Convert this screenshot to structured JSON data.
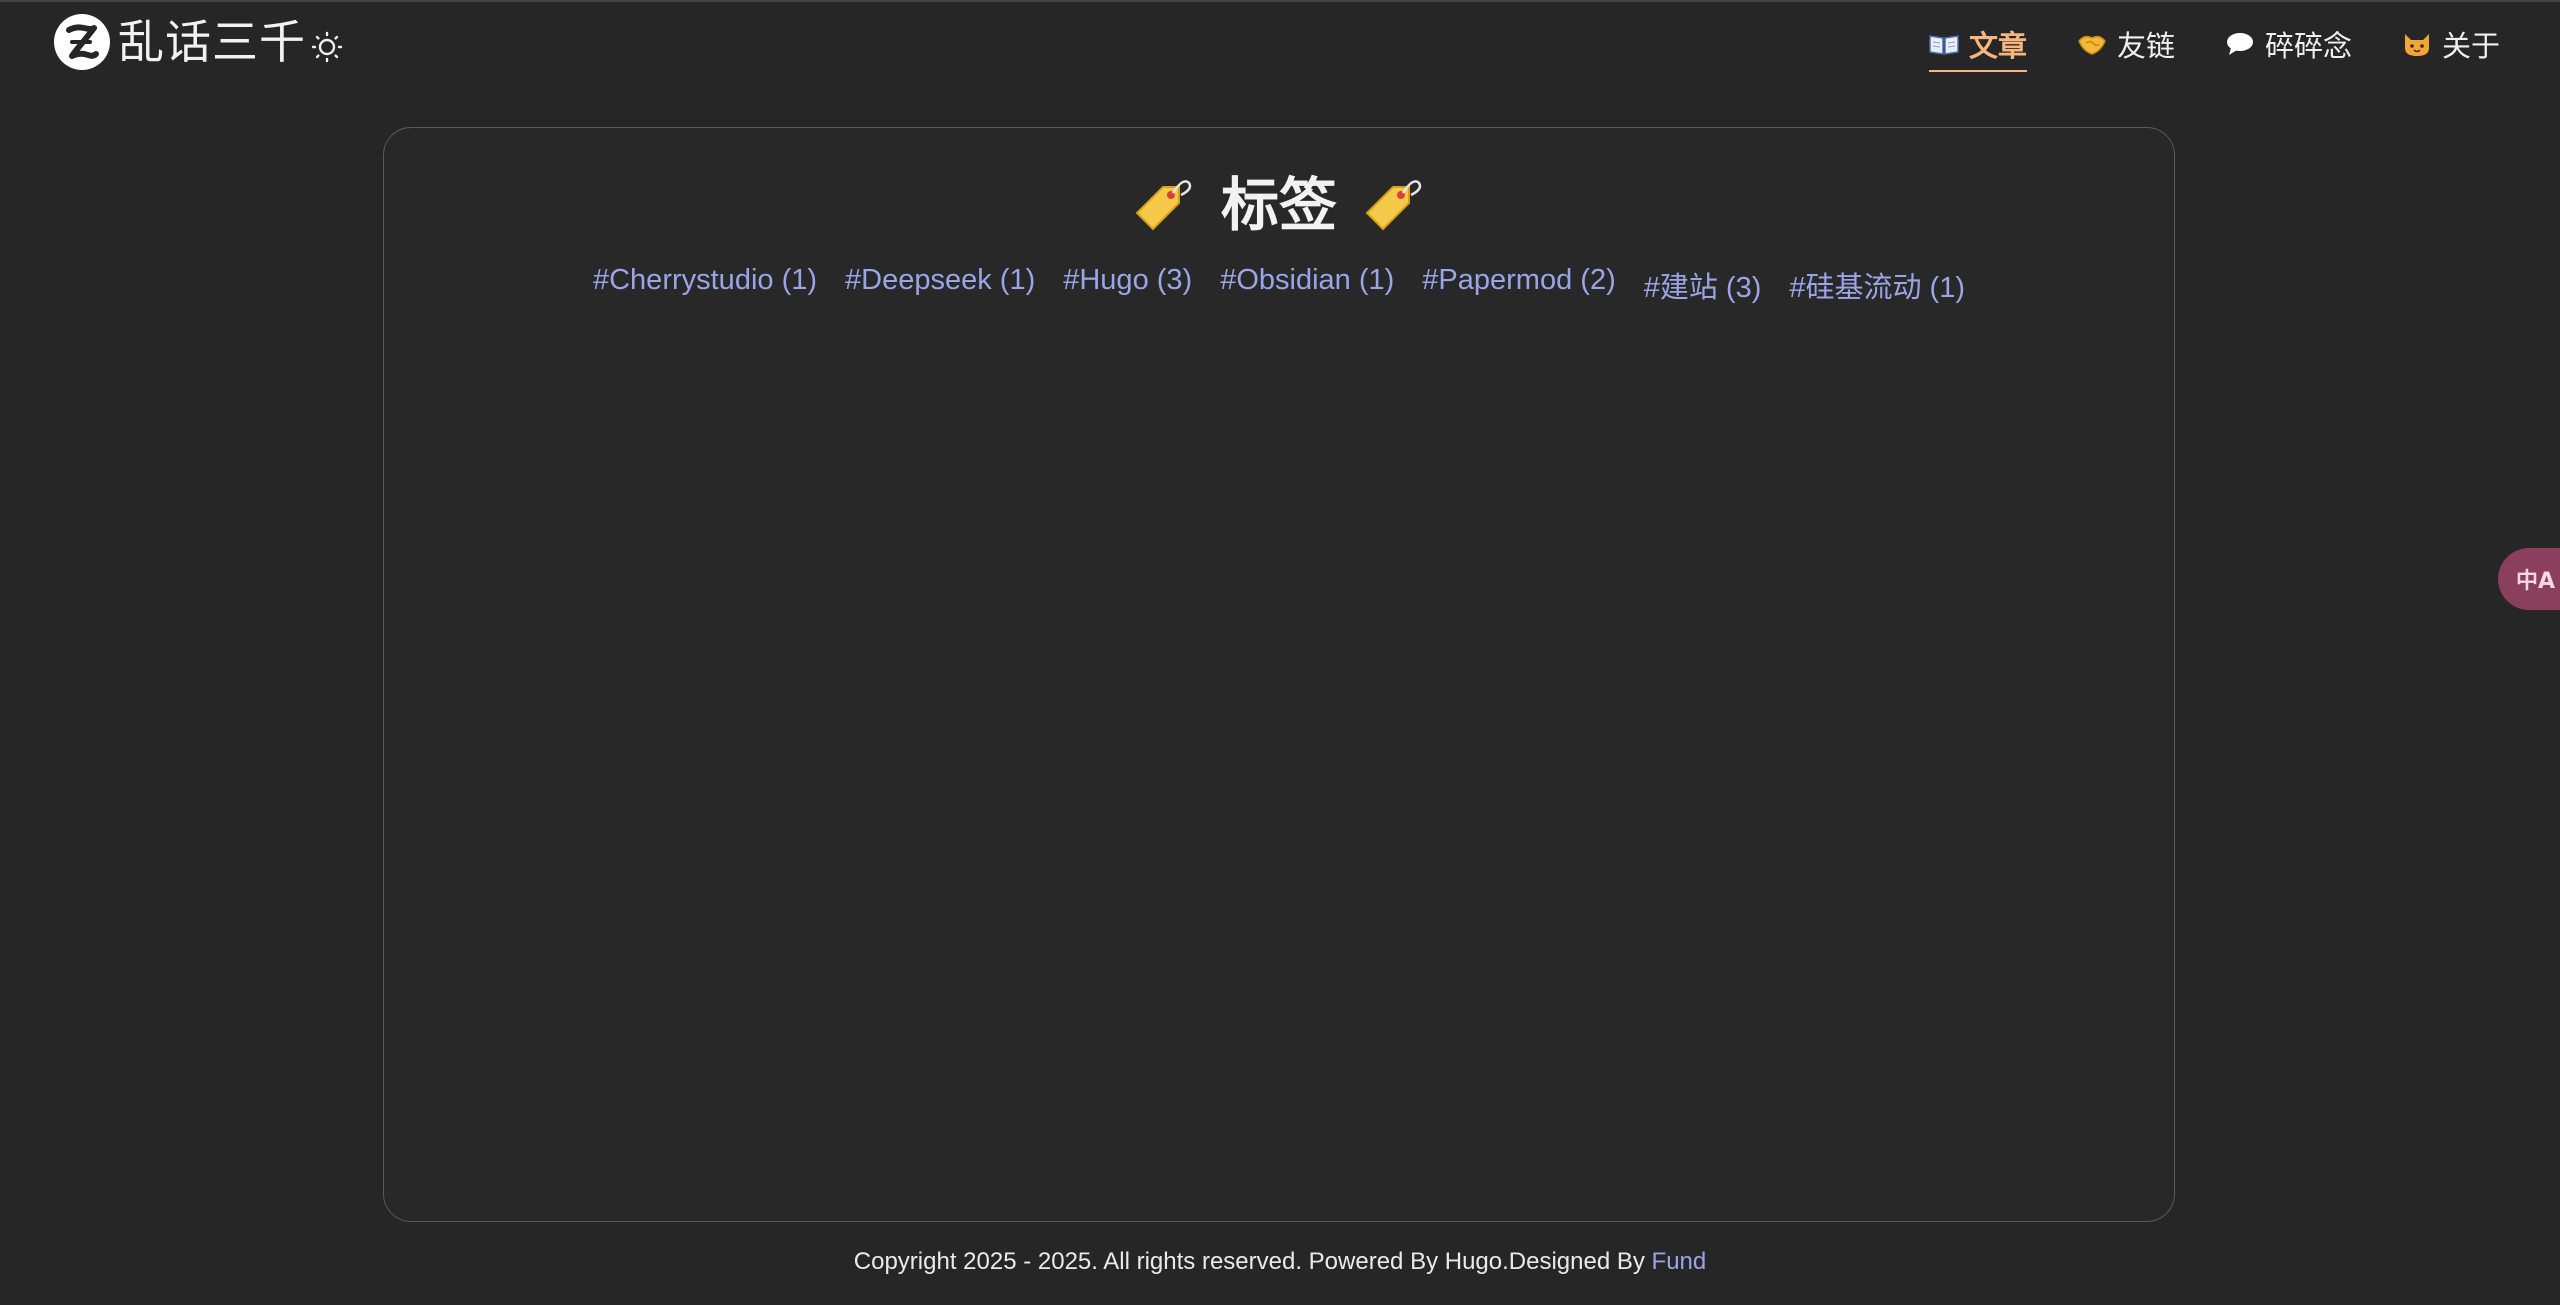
{
  "site": {
    "title": "乱话三千",
    "logo_icon": "z-logo-icon",
    "theme_toggle_icon": "sun-icon"
  },
  "nav": [
    {
      "label": "文章",
      "icon": "open-book-icon",
      "active": true
    },
    {
      "label": "友链",
      "icon": "handshake-icon",
      "active": false
    },
    {
      "label": "碎碎念",
      "icon": "speech-bubble-icon",
      "active": false
    },
    {
      "label": "关于",
      "icon": "cat-face-icon",
      "active": false
    }
  ],
  "page": {
    "title": "标签",
    "title_icon": "label-tag-icon"
  },
  "tags": [
    {
      "label": "#Cherrystudio (1)"
    },
    {
      "label": "#Deepseek (1)"
    },
    {
      "label": "#Hugo (3)"
    },
    {
      "label": "#Obsidian (1)"
    },
    {
      "label": "#Papermod (2)"
    },
    {
      "label": "#建站 (3)"
    },
    {
      "label": "#硅基流动 (1)"
    }
  ],
  "footer": {
    "text": "Copyright 2025 - 2025. All rights reserved. Powered By Hugo.Designed By ",
    "link_label": "Fund"
  },
  "translate_button": {
    "label": "中A",
    "icon": "translate-icon"
  },
  "colors": {
    "background": "#262626",
    "accent": "#f7b67f",
    "link": "#9aa5e8"
  }
}
